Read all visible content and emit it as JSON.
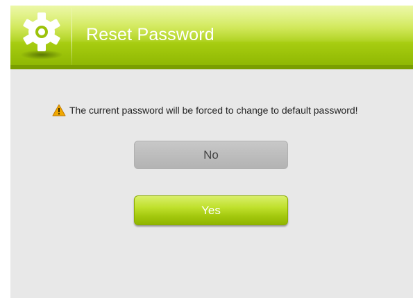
{
  "header": {
    "title": "Reset Password",
    "icon": "gear-icon"
  },
  "message": {
    "icon": "warning-icon",
    "text": "The current password will be forced to change to default password!"
  },
  "buttons": {
    "no_label": "No",
    "yes_label": "Yes"
  },
  "colors": {
    "accent": "#a6cc10",
    "header_light": "#e2f47a",
    "header_dark": "#8bb400",
    "body_bg": "#e8e8e8",
    "neutral_button": "#bdbdbd",
    "warning": "#f0a800"
  }
}
